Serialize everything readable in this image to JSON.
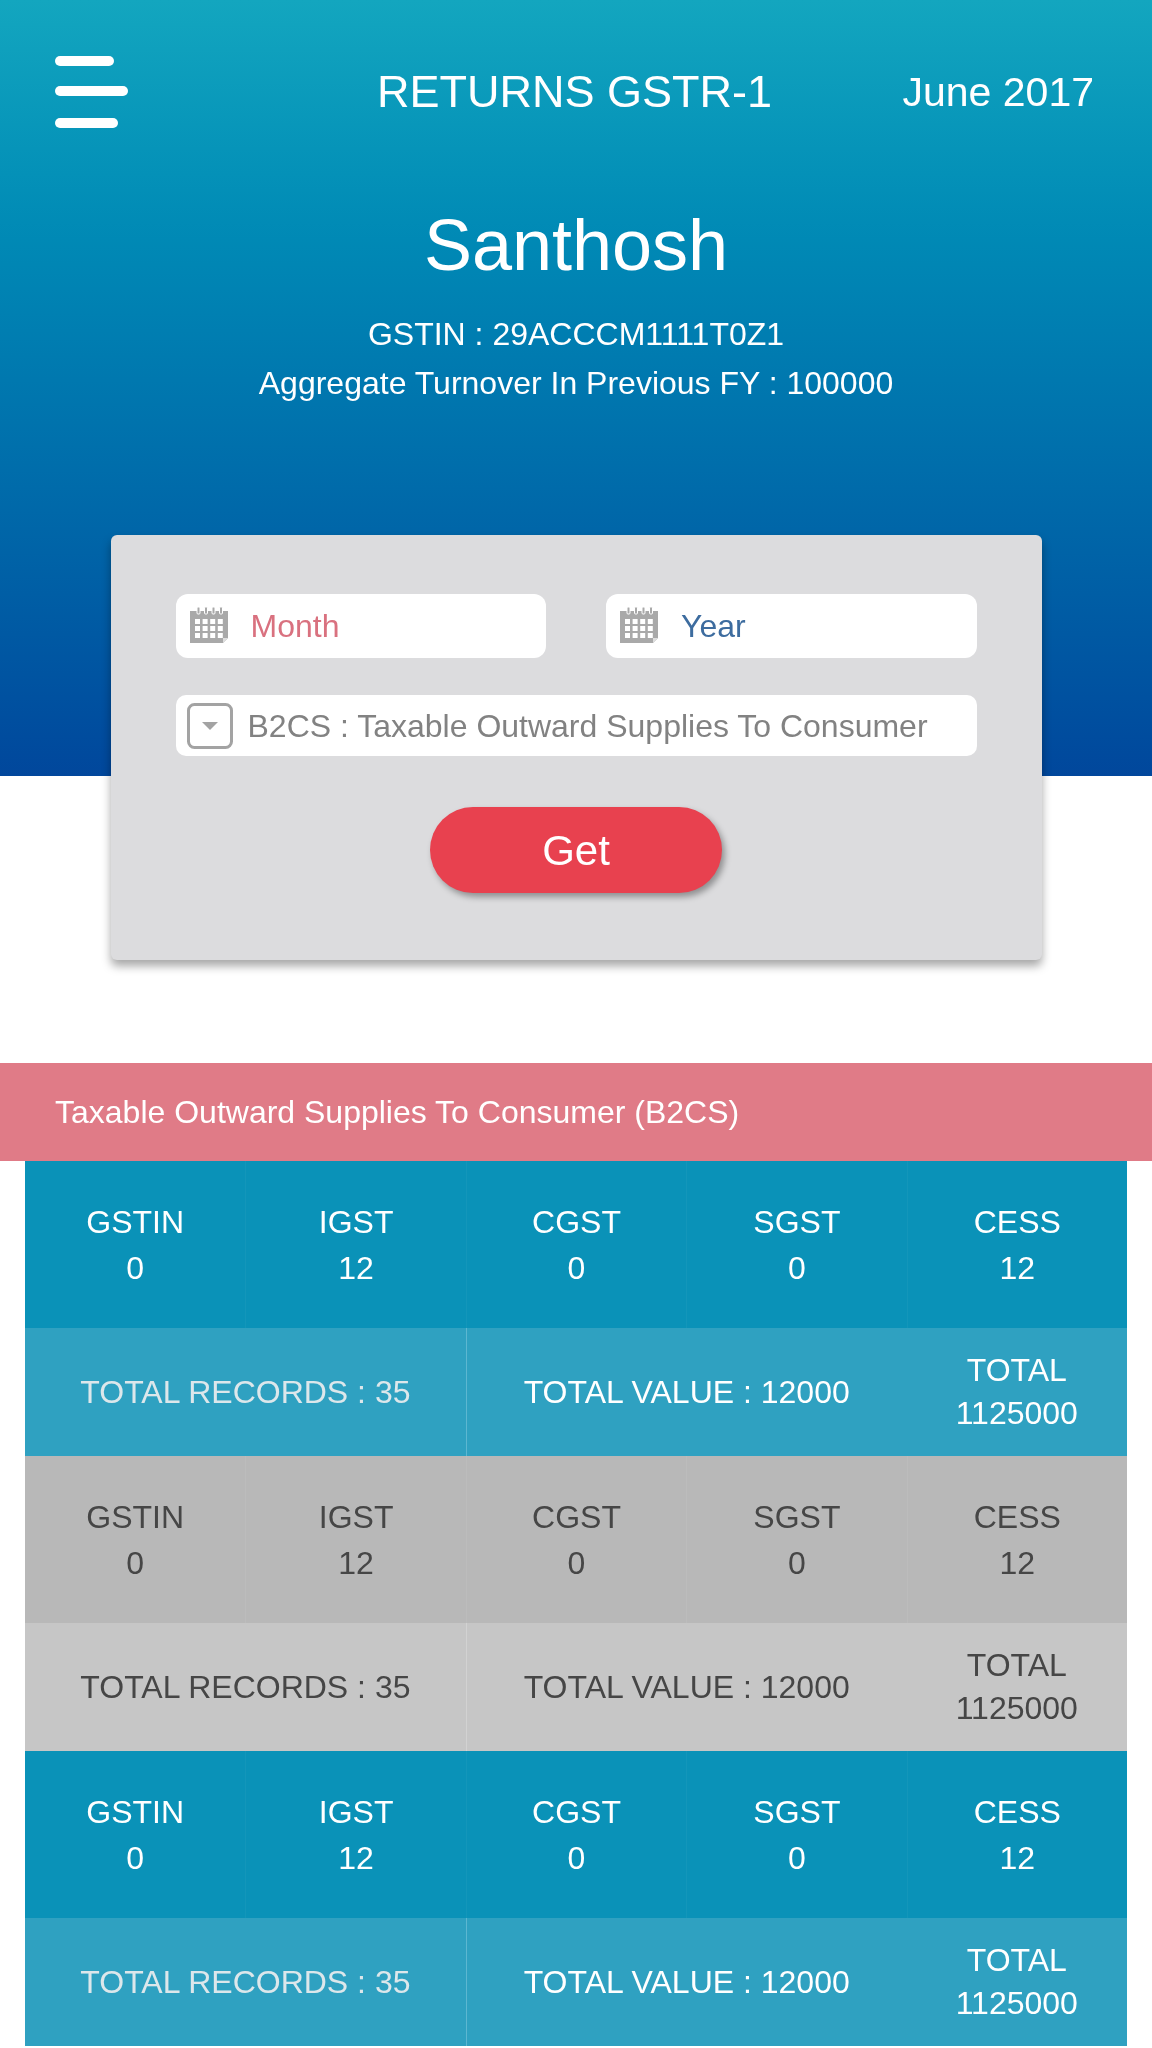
{
  "header": {
    "title": "RETURNS GSTR-1",
    "period": "June 2017"
  },
  "profile": {
    "name": "Santhosh",
    "gstin": "GSTIN : 29ACCCM1111T0Z1",
    "turnover": "Aggregate Turnover In Previous FY : 100000"
  },
  "form": {
    "date_fields": [
      {
        "placeholder": "Month"
      },
      {
        "placeholder": "Year"
      }
    ],
    "return_type": {
      "value": "B2CS : Taxable Outward Supplies To Consumer"
    },
    "button": "Get"
  },
  "section": {
    "title": "Taxable Outward Supplies To Consumer (B2CS)"
  },
  "records": [
    {
      "columns": [
        {
          "label": "GSTIN",
          "value": "0"
        },
        {
          "label": "IGST",
          "value": "12"
        },
        {
          "label": "CGST",
          "value": "0"
        },
        {
          "label": "SGST",
          "value": "0"
        },
        {
          "label": "CESS",
          "value": "12"
        }
      ],
      "total_records": "TOTAL RECORDS : 35",
      "total_value": "TOTAL VALUE : 12000",
      "total_label": "TOTAL",
      "total_amount": "1125000"
    },
    {
      "columns": [
        {
          "label": "GSTIN",
          "value": "0"
        },
        {
          "label": "IGST",
          "value": "12"
        },
        {
          "label": "CGST",
          "value": "0"
        },
        {
          "label": "SGST",
          "value": "0"
        },
        {
          "label": "CESS",
          "value": "12"
        }
      ],
      "total_records": "TOTAL RECORDS : 35",
      "total_value": "TOTAL VALUE : 12000",
      "total_label": "TOTAL",
      "total_amount": "1125000"
    },
    {
      "columns": [
        {
          "label": "GSTIN",
          "value": "0"
        },
        {
          "label": "IGST",
          "value": "12"
        },
        {
          "label": "CGST",
          "value": "0"
        },
        {
          "label": "SGST",
          "value": "0"
        },
        {
          "label": "CESS",
          "value": "12"
        }
      ],
      "total_records": "TOTAL RECORDS : 35",
      "total_value": "TOTAL VALUE : 12000",
      "total_label": "TOTAL",
      "total_amount": "1125000"
    }
  ]
}
